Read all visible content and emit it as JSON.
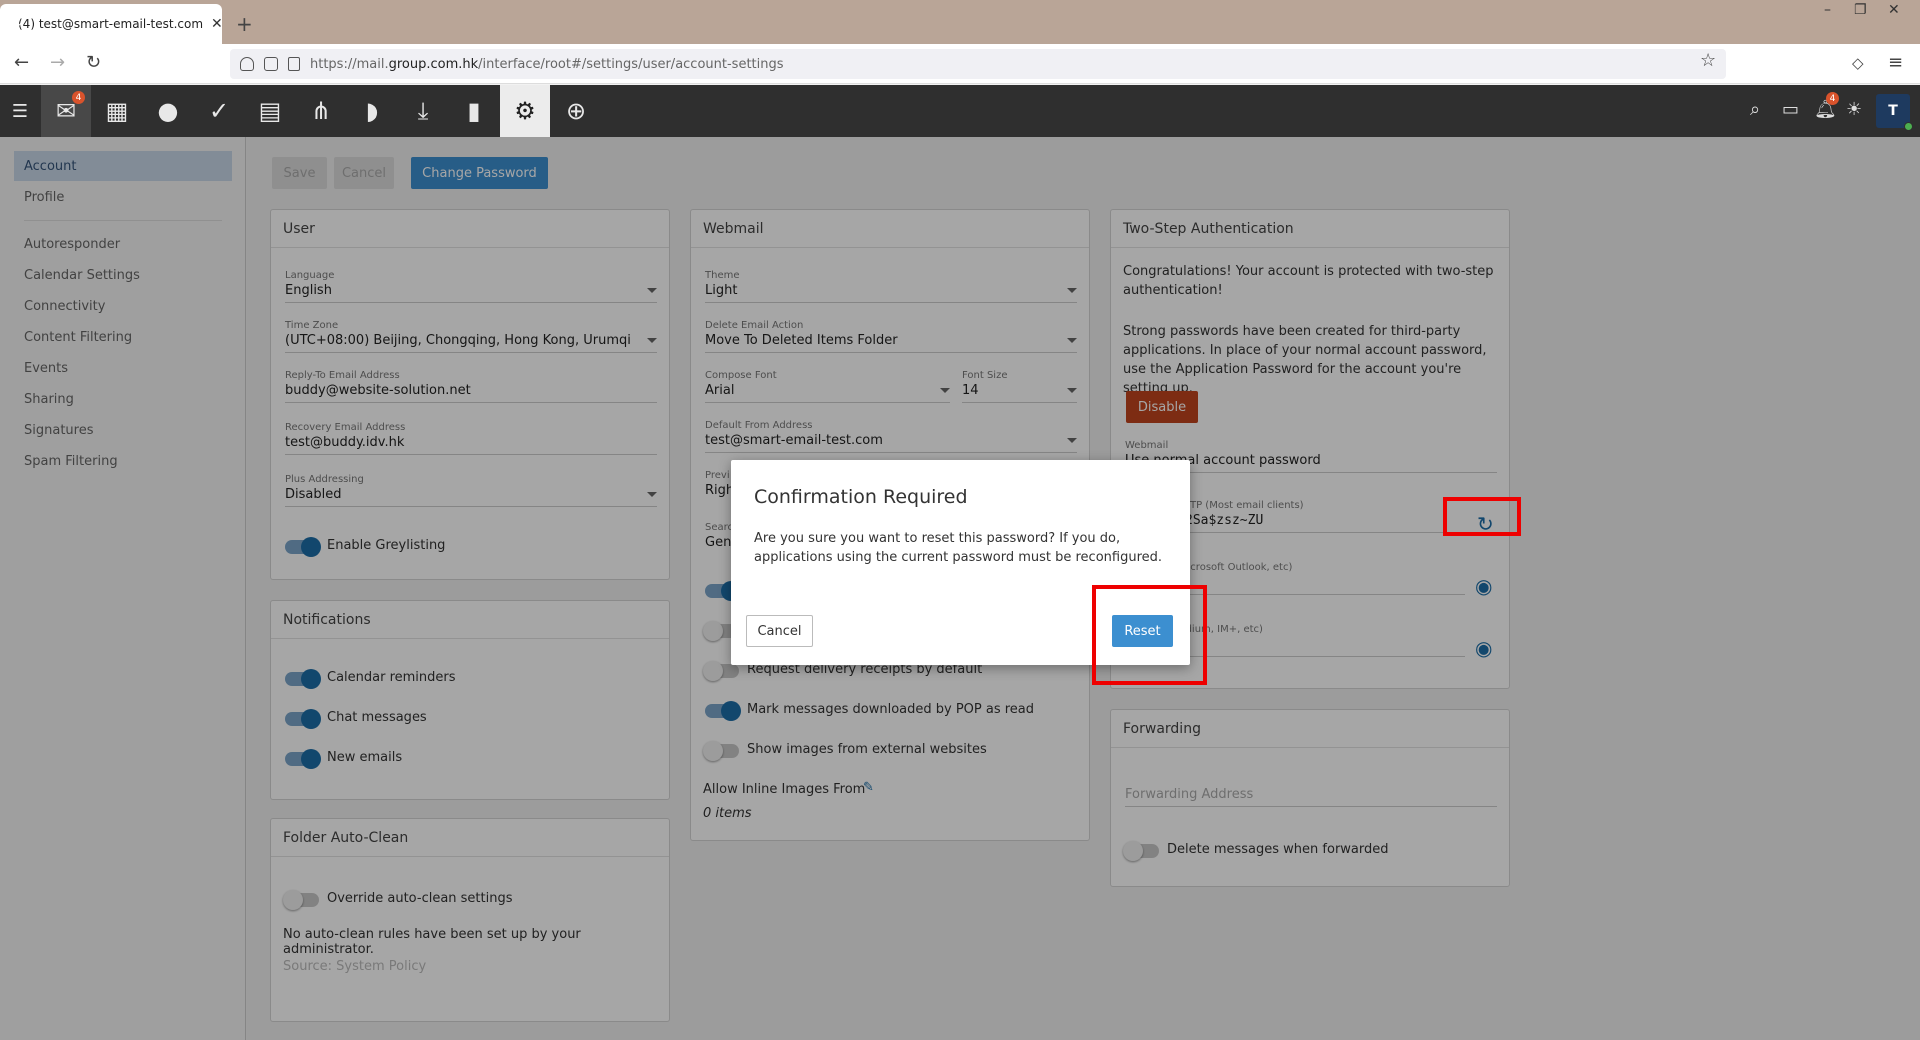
{
  "browser": {
    "tab_title": "(4) test@smart-email-test.com",
    "url_prefix": "https://mail.",
    "url_domain": "group.com.hk",
    "url_path": "/interface/root#/settings/user/account-settings"
  },
  "toolbar": {
    "mail_badge": "4",
    "notif_badge": "4",
    "avatar_letter": "T"
  },
  "sidebar": {
    "items": [
      "Account",
      "Profile",
      "Autoresponder",
      "Calendar Settings",
      "Connectivity",
      "Content Filtering",
      "Events",
      "Sharing",
      "Signatures",
      "Spam Filtering"
    ]
  },
  "actions": {
    "save": "Save",
    "cancel": "Cancel",
    "change_password": "Change Password"
  },
  "user_card": {
    "title": "User",
    "language_label": "Language",
    "language": "English",
    "timezone_label": "Time Zone",
    "timezone": "(UTC+08:00) Beijing, Chongqing, Hong Kong, Urumqi",
    "reply_label": "Reply-To Email Address",
    "reply": "buddy@website-solution.net",
    "recovery_label": "Recovery Email Address",
    "recovery": "test@buddy.idv.hk",
    "plus_label": "Plus Addressing",
    "plus": "Disabled",
    "greylisting": "Enable Greylisting"
  },
  "notifications_card": {
    "title": "Notifications",
    "items": [
      "Calendar reminders",
      "Chat messages",
      "New emails"
    ]
  },
  "autoclean_card": {
    "title": "Folder Auto-Clean",
    "override": "Override auto-clean settings",
    "note": "No auto-clean rules have been set up by your administrator.",
    "source": "Source: System Policy"
  },
  "webmail_card": {
    "title": "Webmail",
    "theme_label": "Theme",
    "theme": "Light",
    "delete_label": "Delete Email Action",
    "delete": "Move To Deleted Items Folder",
    "font_label": "Compose Font",
    "font": "Arial",
    "size_label": "Font Size",
    "size": "14",
    "from_label": "Default From Address",
    "from": "test@smart-email-test.com",
    "preview_label": "Previ",
    "preview": "Righ",
    "search_label": "Searc",
    "search": "Gen",
    "receipts": "Request delivery receipts by default",
    "pop_read": "Mark messages downloaded by POP as read",
    "images": "Show images from external websites",
    "inline": "Allow Inline Images From",
    "inline_count": "0 items"
  },
  "twostep_card": {
    "title": "Two-Step Authentication",
    "congrats": "Congratulations! Your account is protected with two-step authentication!",
    "strong": "Strong passwords have been created for third-party applications. In place of your normal account password, use the Application Password for the account you're setting up.",
    "disable": "Disable",
    "webmail_label": "Webmail",
    "webmail_value": "Use normal account password",
    "smtp_label": "SMTP (Most email clients)",
    "smtp_value": "2Sa$zsz~ZU",
    "outlook_label": "(Microsoft Outlook, etc)",
    "adium_label": "(Adium, IM+, etc)"
  },
  "forwarding_card": {
    "title": "Forwarding",
    "placeholder": "Forwarding Address",
    "delete": "Delete messages when forwarded"
  },
  "dialog": {
    "title": "Confirmation Required",
    "message": "Are you sure you want to reset this password? If you do, applications using the current password must be reconfigured.",
    "cancel": "Cancel",
    "reset": "Reset"
  },
  "colors": {
    "accent": "#3c8fd0",
    "danger": "#c0441e",
    "highlight": "#ee0000"
  }
}
